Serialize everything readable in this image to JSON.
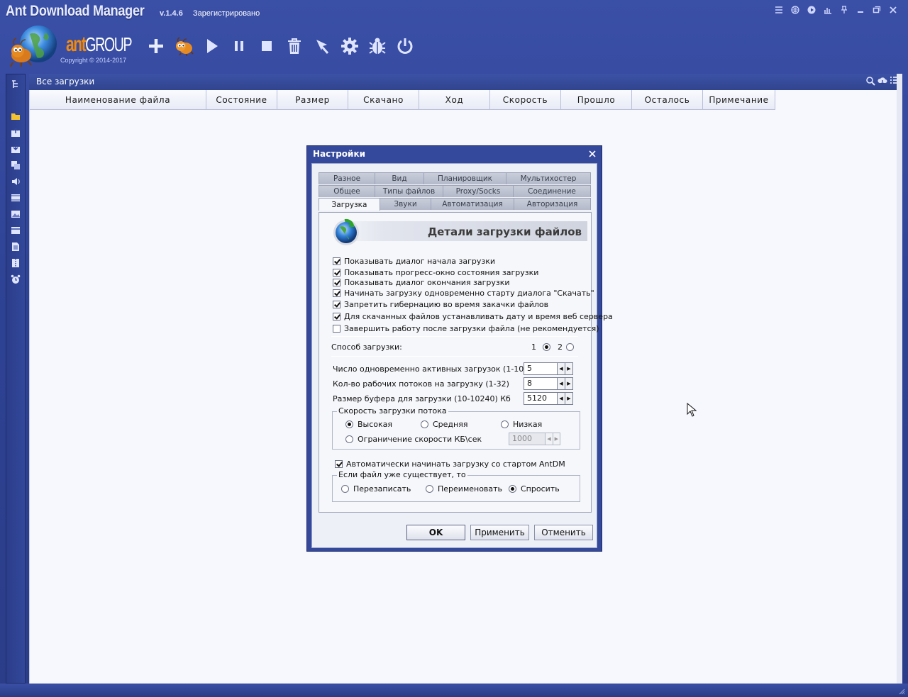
{
  "window": {
    "title": "Ant Download Manager",
    "version": "v.1.4.6",
    "registration": "Зарегистрировано"
  },
  "logo": {
    "brand_ant": "ant",
    "brand_group": "GROUP",
    "copyright": "Copyright © 2014-2017"
  },
  "title_buttons": [
    "menu-icon",
    "globe-icon",
    "play-circle-icon",
    "chart-icon",
    "pin-icon",
    "minimize-icon",
    "restore-icon",
    "close-icon"
  ],
  "toolbar": [
    {
      "name": "add-download-button",
      "icon": "plus-icon"
    },
    {
      "name": "ant-mascot-button",
      "icon": "ant-icon"
    },
    {
      "name": "start-button",
      "icon": "play-icon"
    },
    {
      "name": "pause-button",
      "icon": "pause-icon"
    },
    {
      "name": "stop-button",
      "icon": "stop-icon"
    },
    {
      "name": "delete-button",
      "icon": "trash-icon"
    },
    {
      "name": "cursor-tool-button",
      "icon": "cursor-icon"
    },
    {
      "name": "settings-button",
      "icon": "gear-icon"
    },
    {
      "name": "bug-button",
      "icon": "bug-icon"
    },
    {
      "name": "power-button",
      "icon": "power-icon"
    }
  ],
  "sidebar": [
    "tree-icon",
    "folder-icon",
    "box-up-icon",
    "box-down-icon",
    "copy-icon",
    "audio-icon",
    "video-icon",
    "image-icon",
    "film-icon",
    "document-icon",
    "archive-icon",
    "alarm-clock-icon"
  ],
  "main": {
    "title": "Все загрузки",
    "columns": [
      "Наименование файла",
      "Состояние",
      "Размер",
      "Скачано",
      "Ход",
      "Скорость",
      "Прошло",
      "Осталось",
      "Примечание"
    ]
  },
  "dialog": {
    "title": "Настройки",
    "tabs_row1": [
      "Разное",
      "Вид",
      "Планировщик",
      "Мультихостер"
    ],
    "tabs_row2": [
      "Общее",
      "Типы файлов",
      "Proxy/Socks",
      "Соединение"
    ],
    "tabs_row3": [
      "Загрузка",
      "Звуки",
      "Автоматизация",
      "Авторизация"
    ],
    "active_tab": "Загрузка",
    "banner": "Детали загрузки файлов",
    "checkboxes": [
      {
        "label": "Показывать диалог начала загрузки",
        "checked": true
      },
      {
        "label": "Показывать прогресс-окно состояния загрузки",
        "checked": true
      },
      {
        "label": "Показывать диалог окончания загрузки",
        "checked": true
      },
      {
        "label": "Начинать загрузку одновременно старту диалога \"Скачать\"",
        "checked": true
      },
      {
        "label": "Запретить гибернацию во время закачки файлов",
        "checked": true
      },
      {
        "label": "Для скачанных файлов устанавливать дату и время веб сервера",
        "checked": true
      },
      {
        "label": "Завершить работу после загрузки файла (не рекомендуется)",
        "checked": false
      }
    ],
    "method": {
      "label": "Способ загрузки:",
      "opt1": "1",
      "opt2": "2",
      "selected": "1"
    },
    "spinners": [
      {
        "label": "Число одновременно активных загрузок (1-10)",
        "value": "5"
      },
      {
        "label": "Кол-во рабочих потоков на загрузку (1-32)",
        "value": "8"
      },
      {
        "label": "Размер буфера для загрузки (10-10240) Кб",
        "value": "5120"
      }
    ],
    "speed_group": {
      "title": "Скорость загрузки потока",
      "high": "Высокая",
      "medium": "Средняя",
      "low": "Низкая",
      "limit": "Ограничение скорости КБ\\сек",
      "limit_value": "1000",
      "selected": "Высокая"
    },
    "autostart": {
      "label": "Автоматически начинать загрузку со стартом AntDM",
      "checked": true
    },
    "exists_group": {
      "title": "Если файл уже существует, то",
      "overwrite": "Перезаписать",
      "rename": "Переименовать",
      "ask": "Спросить",
      "selected": "Спросить"
    },
    "buttons": {
      "ok": "OK",
      "apply": "Применить",
      "cancel": "Отменить"
    }
  }
}
